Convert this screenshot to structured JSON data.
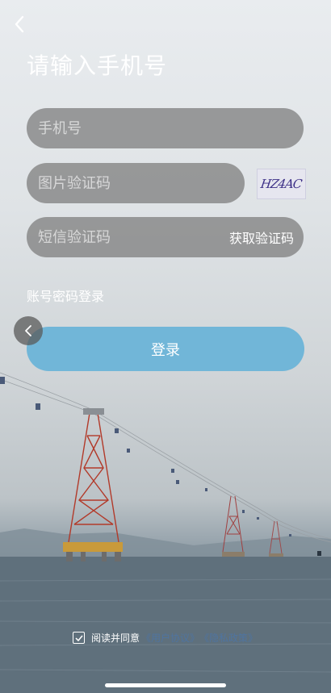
{
  "header": {
    "back_icon": "chevron-left-icon",
    "title": "请输入手机号"
  },
  "form": {
    "phone_placeholder": "手机号",
    "image_code_placeholder": "图片验证码",
    "captcha_text": "HZ4AC",
    "sms_code_placeholder": "短信验证码",
    "get_code_label": "获取验证码"
  },
  "links": {
    "password_login": "账号密码登录"
  },
  "actions": {
    "login_label": "登录",
    "float_back_icon": "chevron-left-icon"
  },
  "agreement": {
    "checked": true,
    "prefix": "阅读并同意",
    "user_agreement": "《用户协议》",
    "privacy_policy": "《隐私政策》"
  },
  "colors": {
    "login_button": "#71b6d8",
    "link": "#4f74a0",
    "field_bg": "rgba(125,125,125,0.75)"
  }
}
